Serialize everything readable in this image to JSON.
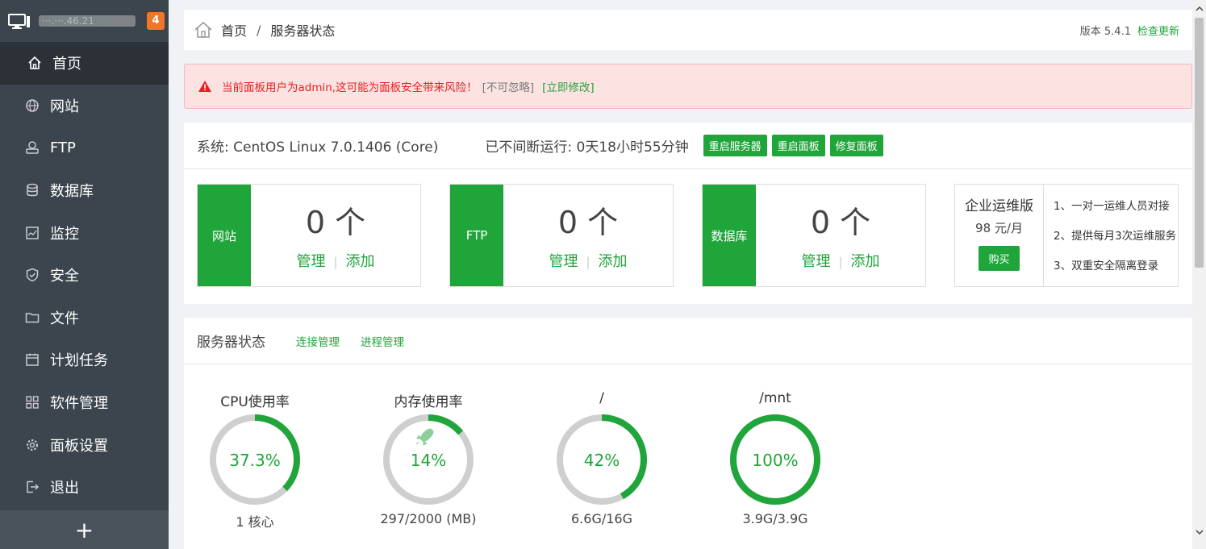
{
  "sidebar": {
    "ip_text": "···.···.46.21",
    "badge": "4",
    "items": [
      {
        "label": "首页",
        "icon": "home-icon"
      },
      {
        "label": "网站",
        "icon": "globe-icon"
      },
      {
        "label": "FTP",
        "icon": "ftp-icon"
      },
      {
        "label": "数据库",
        "icon": "database-icon"
      },
      {
        "label": "监控",
        "icon": "monitor-icon"
      },
      {
        "label": "安全",
        "icon": "shield-icon"
      },
      {
        "label": "文件",
        "icon": "folder-icon"
      },
      {
        "label": "计划任务",
        "icon": "calendar-icon"
      },
      {
        "label": "软件管理",
        "icon": "apps-icon"
      },
      {
        "label": "面板设置",
        "icon": "gear-icon"
      },
      {
        "label": "退出",
        "icon": "logout-icon"
      }
    ],
    "add": "+"
  },
  "breadcrumb": {
    "home": "首页",
    "sep": "/",
    "current": "服务器状态",
    "version": "版本 5.4.1",
    "check_update": "检查更新"
  },
  "alert": {
    "message": "当前面板用户为admin,这可能为面板安全带来风险！",
    "ignore": "[不可忽略]",
    "fix": "[立即修改]"
  },
  "system": {
    "os": "系统: CentOS Linux 7.0.1406 (Core)",
    "uptime": "已不间断运行: 0天18小时55分钟",
    "btn_restart_server": "重启服务器",
    "btn_restart_panel": "重启面板",
    "btn_repair_panel": "修复面板"
  },
  "stats": [
    {
      "label": "网站",
      "count": "0 个",
      "manage": "管理",
      "add": "添加"
    },
    {
      "label": "FTP",
      "count": "0 个",
      "manage": "管理",
      "add": "添加"
    },
    {
      "label": "数据库",
      "count": "0 个",
      "manage": "管理",
      "add": "添加"
    }
  ],
  "enterprise": {
    "title": "企业运维版",
    "price": "98 元/月",
    "buy": "购买",
    "features": [
      "1、一对一运维人员对接",
      "2、提供每月3次运维服务",
      "3、双重安全隔离登录"
    ]
  },
  "status": {
    "title": "服务器状态",
    "conn": "连接管理",
    "proc": "进程管理",
    "gauges": [
      {
        "title": "CPU使用率",
        "value": "37.3%",
        "percent": 37.3,
        "bottom": "1 核心"
      },
      {
        "title": "内存使用率",
        "value": "14%",
        "percent": 14,
        "bottom": "297/2000 (MB)",
        "rocket": true
      },
      {
        "title": "/",
        "value": "42%",
        "percent": 42,
        "bottom": "6.6G/16G"
      },
      {
        "title": "/mnt",
        "value": "100%",
        "percent": 100,
        "bottom": "3.9G/3.9G"
      }
    ]
  },
  "colors": {
    "accent": "#20a53a",
    "sidebar": "#3c444d",
    "danger": "#e81f1f"
  }
}
